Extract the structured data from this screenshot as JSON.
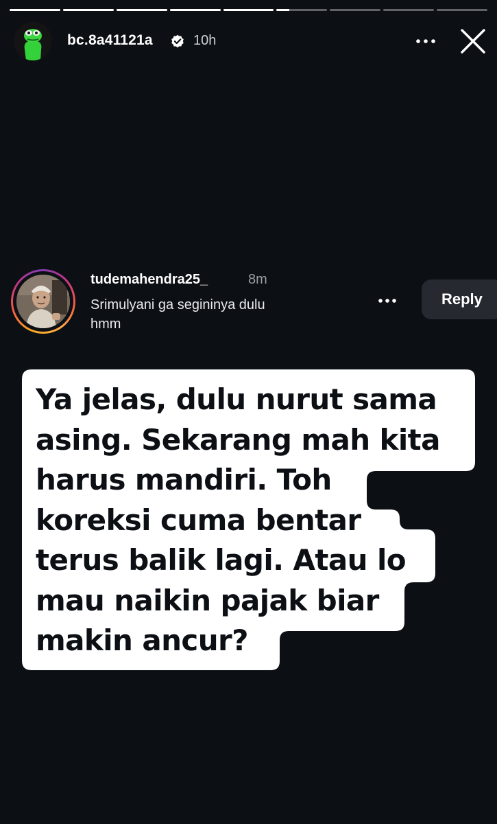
{
  "story": {
    "progress_segments": [
      1,
      1,
      1,
      1,
      1,
      0.25,
      0,
      0,
      0
    ],
    "header": {
      "username": "bc.8a41121a",
      "verified_icon": "verified-badge-icon",
      "time": "10h",
      "more_icon": "more-horizontal-icon",
      "close_icon": "close-icon"
    }
  },
  "comment": {
    "username": "tudemahendra25_",
    "time": "8m",
    "text": "Srimulyani ga segininya dulu hmm",
    "more_icon": "more-horizontal-icon",
    "reply_label": "Reply"
  },
  "sticker": {
    "lines": [
      "Ya jelas, dulu nurut sama",
      "asing. Sekarang mah kita",
      "harus mandiri. Toh",
      "koreksi cuma bentar",
      "terus balik lagi. Atau lo",
      "mau naikin pajak biar",
      "makin ancur?"
    ]
  },
  "colors": {
    "background": "#0c0f14",
    "sticker_bg": "#ffffff",
    "sticker_text": "#0c0f14",
    "reply_bg": "#262a30"
  }
}
